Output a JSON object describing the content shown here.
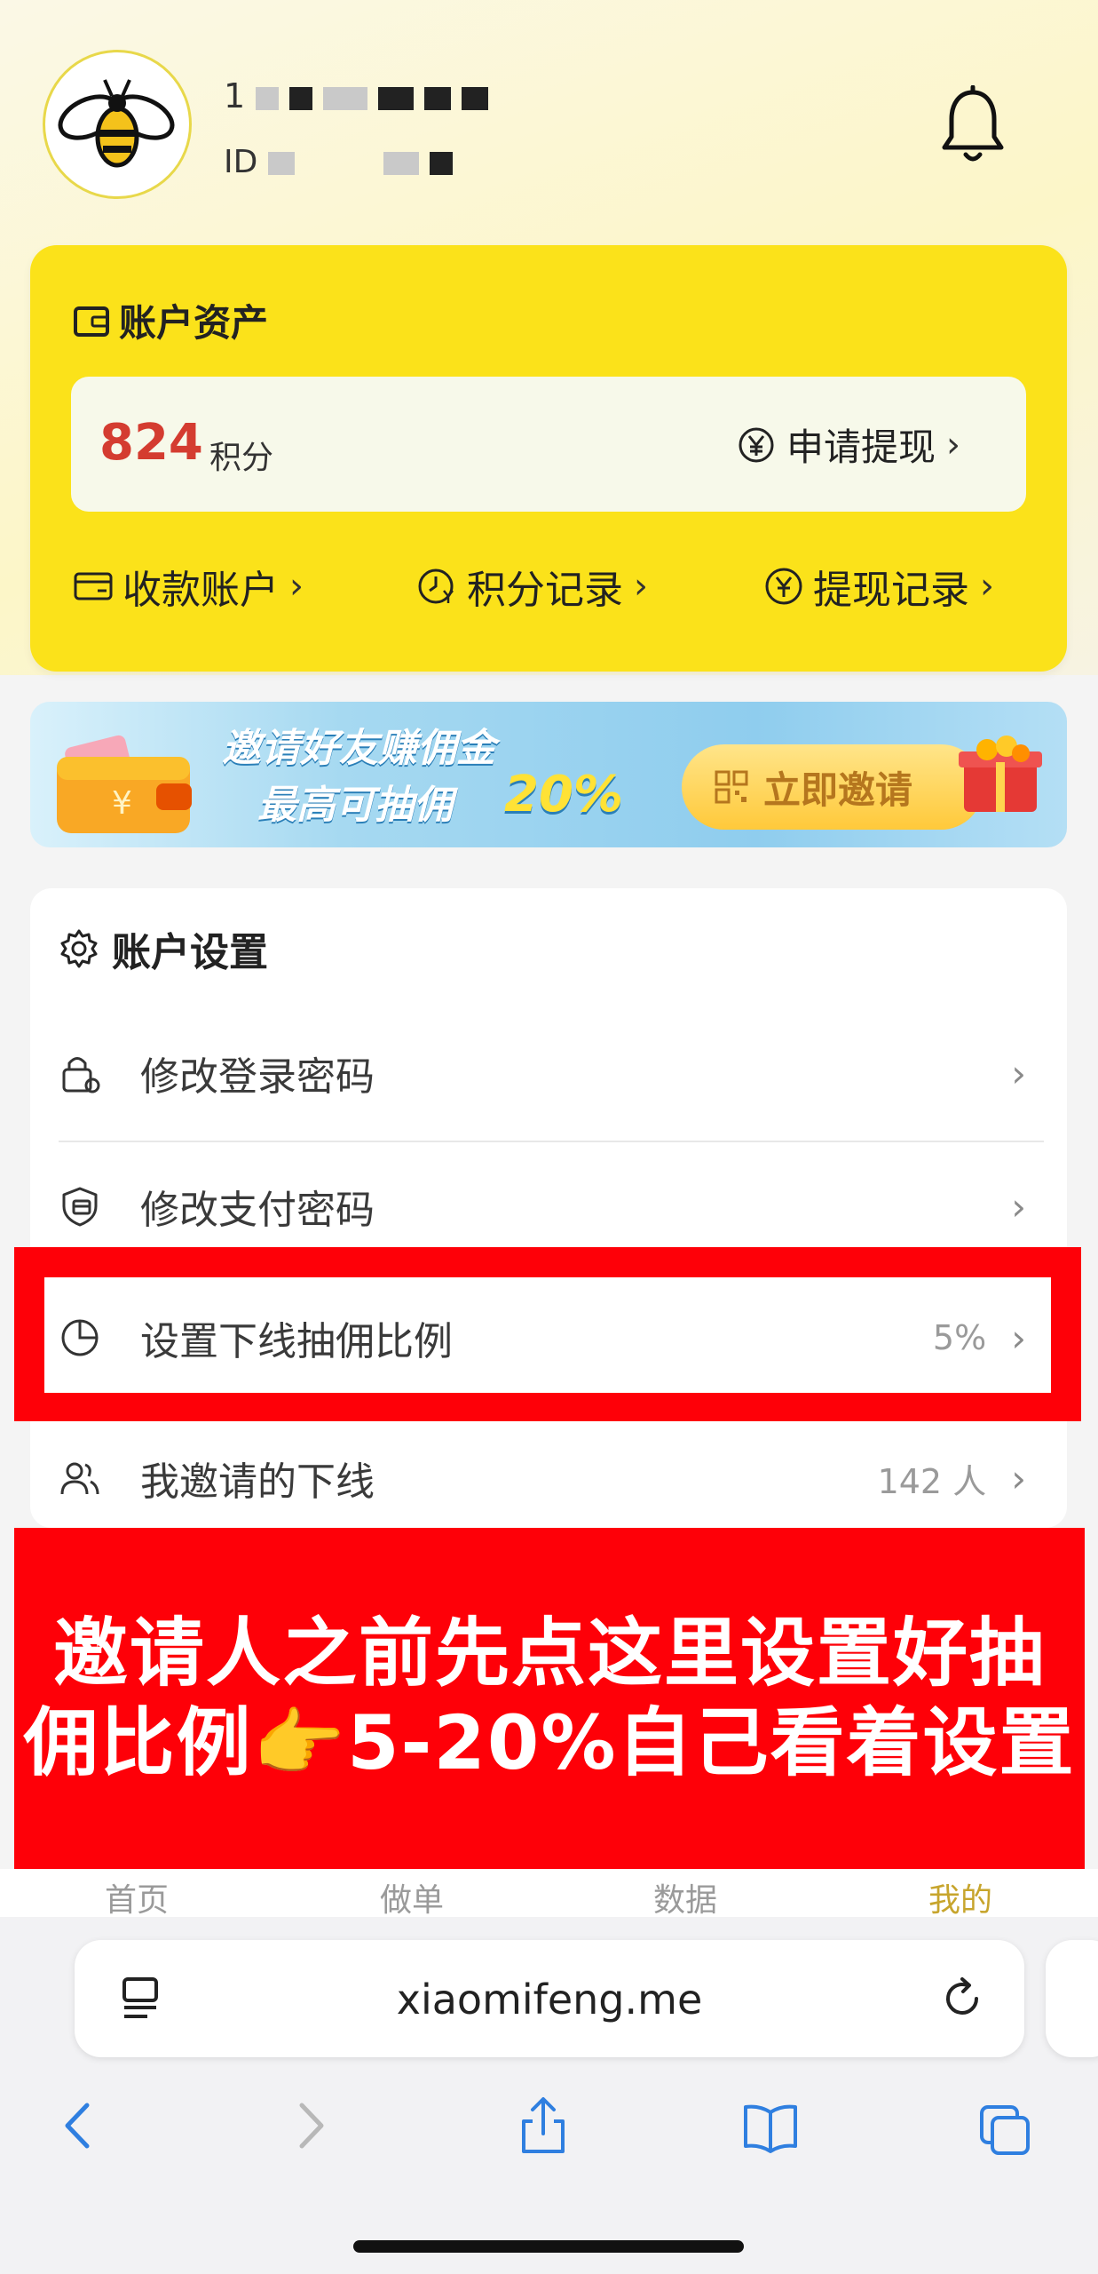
{
  "profile": {
    "name_prefix": "1",
    "id_prefix": "ID"
  },
  "assets": {
    "title": "账户资产",
    "points_value": "824",
    "points_unit": "积分",
    "withdraw_label": "申请提现",
    "links": [
      {
        "label": "收款账户"
      },
      {
        "label": "积分记录"
      },
      {
        "label": "提现记录"
      }
    ]
  },
  "banner": {
    "line1": "邀请好友赚佣金",
    "line2": "最高可抽佣",
    "percent": "20%",
    "button_label": "立即邀请"
  },
  "settings": {
    "title": "账户设置",
    "rows": [
      {
        "label": "修改登录密码",
        "value": ""
      },
      {
        "label": "修改支付密码",
        "value": ""
      },
      {
        "label": "设置下线抽佣比例",
        "value": "5%"
      },
      {
        "label": "我邀请的下线",
        "value": "142 人"
      }
    ]
  },
  "callout": {
    "line1": "邀请人之前先点这里设置好抽",
    "line2_a": "佣比例",
    "line2_emoji": "👉",
    "line2_b": "5-20%自己看着设置"
  },
  "tabs": [
    {
      "label": "首页",
      "active": false
    },
    {
      "label": "做单",
      "active": false
    },
    {
      "label": "数据",
      "active": false
    },
    {
      "label": "我的",
      "active": true
    }
  ],
  "browser": {
    "url": "xiaomifeng.me"
  },
  "colors": {
    "assets_card": "#fbe21a",
    "points_red": "#d43c30",
    "highlight_red": "#fe0008",
    "active_tab": "#c7a52d"
  }
}
